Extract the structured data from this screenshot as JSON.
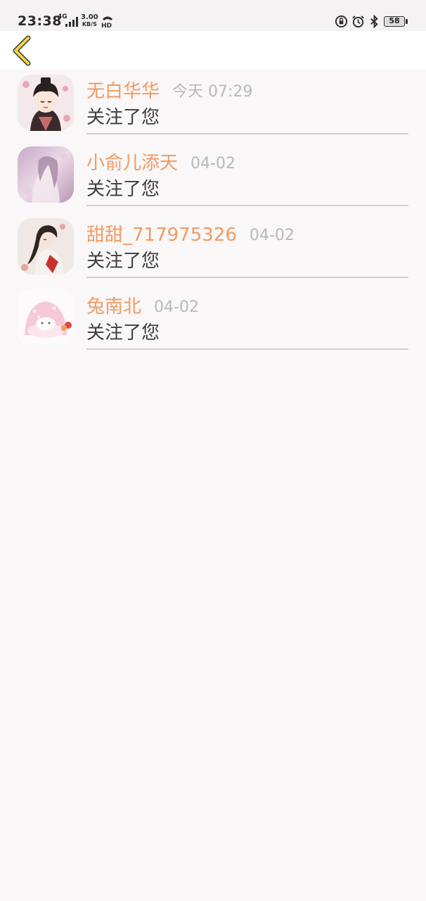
{
  "status_bar": {
    "time": "23:38",
    "network": "4G",
    "speed_value": "3.00",
    "speed_unit": "KB/S",
    "hd": "HD",
    "battery": "58",
    "icons": [
      "signal-icon",
      "hd-call-icon",
      "lock-rotation-icon",
      "alarm-icon",
      "bluetooth-icon",
      "battery-icon"
    ]
  },
  "header": {
    "back_icon": "chevron-left-icon",
    "accent_color": "#f5d547"
  },
  "notifications": [
    {
      "name": "无白华华",
      "time": "今天 07:29",
      "message": "关注了您"
    },
    {
      "name": "小俞儿添天",
      "time": "04-02",
      "message": "关注了您"
    },
    {
      "name": "甜甜_717975326",
      "time": "04-02",
      "message": "关注了您"
    },
    {
      "name": "兔南北",
      "time": "04-02",
      "message": "关注了您"
    }
  ],
  "colors": {
    "name": "#f19a5f",
    "time": "#b8b8b8",
    "message": "#3d3d3d",
    "background": "#f9f7f8"
  }
}
